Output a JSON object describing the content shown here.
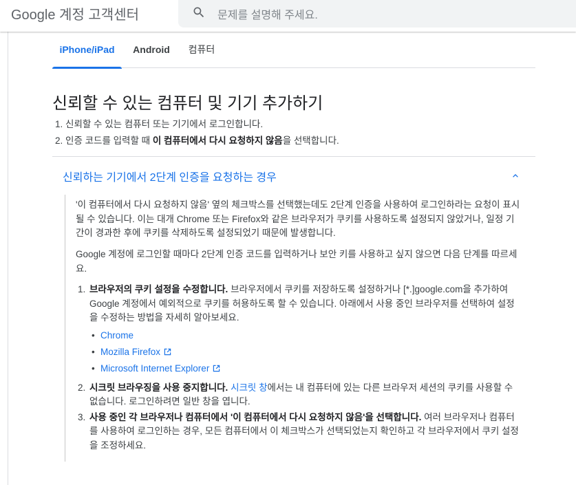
{
  "header": {
    "logo": "Google 계정 고객센터",
    "search_placeholder": "문제를 설명해 주세요."
  },
  "tabs": [
    {
      "label": "iPhone/iPad",
      "active": true
    },
    {
      "label": "Android",
      "active": false
    },
    {
      "label": "컴퓨터",
      "active": false
    }
  ],
  "section": {
    "title": "신뢰할 수 있는 컴퓨터 및 기기 추가하기",
    "steps": [
      {
        "num": "1.",
        "text": "신뢰할 수 있는 컴퓨터 또는 기기에서 로그인합니다."
      },
      {
        "num": "2.",
        "pre": "인증 코드를 입력할 때 ",
        "bold": "이 컴퓨터에서 다시 요청하지 않음",
        "post": "을 선택합니다."
      }
    ]
  },
  "accordion": {
    "title": "신뢰하는 기기에서 2단계 인증을 요청하는 경우",
    "expanded": true,
    "para1": "'이 컴퓨터에서 다시 요청하지 않음' 옆의 체크박스를 선택했는데도 2단계 인증을 사용하여 로그인하라는 요청이 표시될 수 있습니다. 이는 대개 Chrome 또는 Firefox와 같은 브라우저가 쿠키를 사용하도록 설정되지 않았거나, 일정 기간이 경과한 후에 쿠키를 삭제하도록 설정되었기 때문에 발생합니다.",
    "para2": "Google 계정에 로그인할 때마다 2단계 인증 코드를 입력하거나 보안 키를 사용하고 싶지 않으면 다음 단계를 따르세요.",
    "items": [
      {
        "num": "1.",
        "bold": "브라우저의 쿠키 설정을 수정합니다.",
        "text": " 브라우저에서 쿠키를 저장하도록 설정하거나 [*.]google.com을 추가하여 Google 계정에서 예외적으로 쿠키를 허용하도록 할 수 있습니다. 아래에서 사용 중인 브라우저를 선택하여 설정을 수정하는 방법을 자세히 알아보세요.",
        "links": [
          {
            "label": "Chrome",
            "external": false
          },
          {
            "label": "Mozilla Firefox",
            "external": true
          },
          {
            "label": "Microsoft Internet Explorer",
            "external": true
          }
        ]
      },
      {
        "num": "2.",
        "bold": "시크릿 브라우징을 사용 중지합니다.",
        "space": " ",
        "link": "시크릿 창",
        "text": "에서는 내 컴퓨터에 있는 다른 브라우저 세션의 쿠키를 사용할 수 없습니다. 로그인하려면 일반 창을 엽니다."
      },
      {
        "num": "3.",
        "bold": "사용 중인 각 브라우저나 컴퓨터에서 '이 컴퓨터에서 다시 요청하지 않음'을 선택합니다.",
        "text": " 여러 브라우저나 컴퓨터를 사용하여 로그인하는 경우, 모든 컴퓨터에서 이 체크박스가 선택되었는지 확인하고 각 브라우저에서 쿠키 설정을 조정하세요."
      }
    ]
  },
  "colors": {
    "accent": "#1a73e8",
    "text": "#3c4043",
    "divider": "#dadce0"
  },
  "icons": [
    "search-icon",
    "chevron-up-icon",
    "external-link-icon"
  ]
}
